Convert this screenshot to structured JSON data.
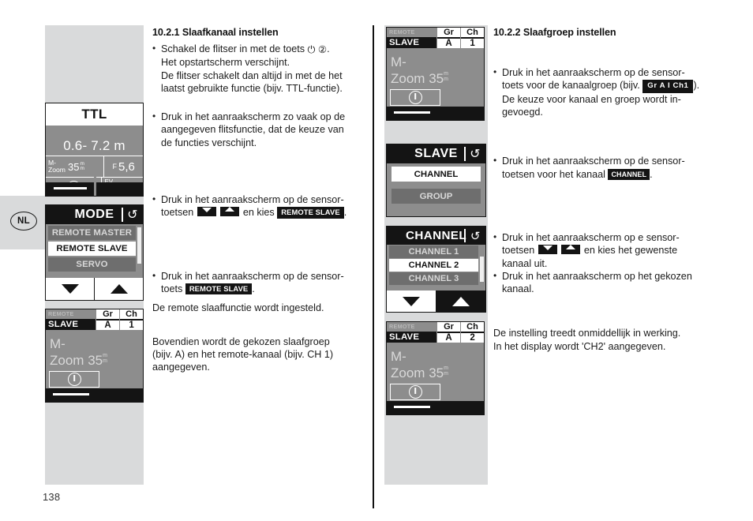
{
  "page": {
    "number": "138",
    "language_tab": "NL"
  },
  "sections": {
    "left": {
      "heading": "10.2.1 Slaafkanaal instellen",
      "blocks": [
        {
          "type": "bullet",
          "lines": [
            "Schakel de flitser in met de toets",
            "Het opstartscherm verschijnt.",
            "De flitser schakelt dan altijd in met de het",
            "laatst gebruikte functie (bijv. TTL-functie)."
          ],
          "power_icon": "⏻",
          "ref_num": "②",
          "trailing": "."
        },
        {
          "type": "bullet",
          "lines": [
            "Druk in het aanraakscherm zo vaak op de",
            "aangegeven flitsfunctie, dat de keuze van",
            "de functies verschijnt."
          ]
        },
        {
          "type": "bullet",
          "lines": [
            "Druk in het aanraakscherm op de sensor-",
            "toetsen"
          ],
          "mid_text": "en kies",
          "chip": "REMOTE SLAVE",
          "trailing": "."
        },
        {
          "type": "bullet",
          "lines": [
            "Druk in het aanraakscherm op de sensor-",
            "toets"
          ],
          "chip": "REMOTE SLAVE",
          "trailing": "."
        },
        {
          "type": "para",
          "lines": [
            "De remote slaaffunctie wordt ingesteld."
          ]
        },
        {
          "type": "para",
          "lines": [
            "Bovendien wordt de gekozen slaafgroep",
            "(bijv. A) en het remote-kanaal (bijv. CH 1)",
            "aangegeven."
          ]
        }
      ]
    },
    "right": {
      "heading": "10.2.2 Slaafgroep instellen",
      "blocks": [
        {
          "type": "bullet",
          "lines": [
            "Druk in het aanraakscherm op de sensor-",
            "toets voor de kanaalgroep (bijv.",
            "De keuze voor kanaal en groep wordt in-",
            "gevoegd."
          ],
          "chip": "Gr A  I  Ch1",
          "trailing": ")."
        },
        {
          "type": "bullet",
          "lines": [
            "Druk in het aanraakscherm op de sensor-",
            "toetsen voor het kanaal"
          ],
          "chip": "CHANNEL",
          "trailing": "."
        },
        {
          "type": "bullet",
          "lines": [
            "Druk in het aanraakscherm op e sensor-",
            "toetsen"
          ],
          "mid_text": "en kies het gewenste",
          "last_line": "kanaal uit."
        },
        {
          "type": "bullet",
          "lines": [
            "Druk in het aanraakscherm op het gekozen",
            "kanaal."
          ]
        },
        {
          "type": "para",
          "lines": [
            "De instelling treedt onmiddellijk in werking.",
            "In het display wordt 'CH2' aangegeven."
          ]
        }
      ]
    }
  },
  "screens": {
    "ttl": {
      "mode_label": "TTL",
      "distance": "0.6- 7.2 m",
      "zoom_label_line1": "M-",
      "zoom_label_line2": "Zoom",
      "zoom_value": "35",
      "zoom_unit_top": "m",
      "zoom_unit_bottom": "m",
      "aperture_prefix": "F",
      "aperture_value": "5,6",
      "ev_label": "EV",
      "info_icon": "info-circle-icon"
    },
    "mode": {
      "title": "MODE",
      "back_icon": "↺",
      "items": [
        {
          "label": "REMOTE MASTER",
          "selected": false
        },
        {
          "label": "REMOTE SLAVE",
          "selected": true
        },
        {
          "label": "SERVO",
          "selected": false
        }
      ],
      "down_arrow": "down-arrow-icon",
      "up_arrow": "up-arrow-icon"
    },
    "status1": {
      "remote_label": "REMOTE",
      "slave_label": "SLAVE",
      "group_key": "Gr",
      "group_value": "A",
      "channel_key": "Ch",
      "channel_value": "1",
      "mode_line1": "M-",
      "mode_line2": "Zoom",
      "zoom_value": "35",
      "zoom_unit_top": "m",
      "zoom_unit_bottom": "m"
    },
    "status2": {
      "remote_label": "REMOTE",
      "slave_label": "SLAVE",
      "group_key": "Gr",
      "group_value": "A",
      "channel_key": "Ch",
      "channel_value": "1",
      "mode_line1": "M-",
      "mode_line2": "Zoom",
      "zoom_value": "35",
      "zoom_unit_top": "m",
      "zoom_unit_bottom": "m"
    },
    "status3": {
      "remote_label": "REMOTE",
      "slave_label": "SLAVE",
      "group_key": "Gr",
      "group_value": "A",
      "channel_key": "Ch",
      "channel_value": "2",
      "mode_line1": "M-",
      "mode_line2": "Zoom",
      "zoom_value": "35",
      "zoom_unit_top": "m",
      "zoom_unit_bottom": "m"
    },
    "slave_menu": {
      "title": "SLAVE",
      "back_icon": "↺",
      "items": [
        {
          "label": "CHANNEL",
          "selected": true
        },
        {
          "label": "GROUP",
          "selected": false
        }
      ]
    },
    "channel_menu": {
      "title": "CHANNEL",
      "back_icon": "↺",
      "items": [
        {
          "label": "CHANNEL 1",
          "selected": false
        },
        {
          "label": "CHANNEL 2",
          "selected": true
        },
        {
          "label": "CHANNEL 3",
          "selected": false
        }
      ],
      "down_arrow": "down-arrow-icon",
      "up_arrow": "up-arrow-icon"
    }
  },
  "colors": {
    "lcd_background": "#8d8d8d",
    "lcd_dark": "#141414",
    "column_grey": "#d9dadb",
    "selected_white": "#ffffff"
  }
}
